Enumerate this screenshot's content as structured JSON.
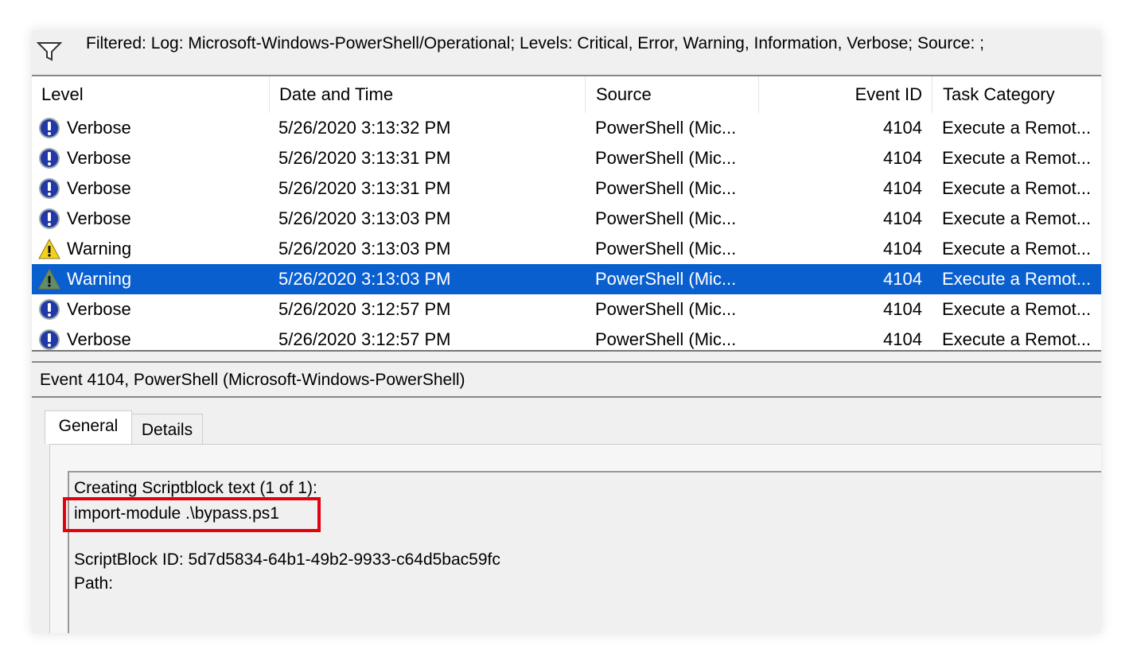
{
  "filter": {
    "icon": "funnel-icon",
    "text": "Filtered: Log: Microsoft-Windows-PowerShell/Operational; Levels: Critical, Error, Warning, Information, Verbose; Source: ;"
  },
  "columns": [
    "Level",
    "Date and Time",
    "Source",
    "Event ID",
    "Task Category"
  ],
  "rows": [
    {
      "level": "Verbose",
      "datetime": "5/26/2020 3:13:32 PM",
      "source": "PowerShell (Mic...",
      "event_id": "4104",
      "task": "Execute a Remot..."
    },
    {
      "level": "Verbose",
      "datetime": "5/26/2020 3:13:31 PM",
      "source": "PowerShell (Mic...",
      "event_id": "4104",
      "task": "Execute a Remot..."
    },
    {
      "level": "Verbose",
      "datetime": "5/26/2020 3:13:31 PM",
      "source": "PowerShell (Mic...",
      "event_id": "4104",
      "task": "Execute a Remot..."
    },
    {
      "level": "Verbose",
      "datetime": "5/26/2020 3:13:03 PM",
      "source": "PowerShell (Mic...",
      "event_id": "4104",
      "task": "Execute a Remot..."
    },
    {
      "level": "Warning",
      "datetime": "5/26/2020 3:13:03 PM",
      "source": "PowerShell (Mic...",
      "event_id": "4104",
      "task": "Execute a Remot..."
    },
    {
      "level": "Warning",
      "datetime": "5/26/2020 3:13:03 PM",
      "source": "PowerShell (Mic...",
      "event_id": "4104",
      "task": "Execute a Remot...",
      "selected": true
    },
    {
      "level": "Verbose",
      "datetime": "5/26/2020 3:12:57 PM",
      "source": "PowerShell (Mic...",
      "event_id": "4104",
      "task": "Execute a Remot..."
    },
    {
      "level": "Verbose",
      "datetime": "5/26/2020 3:12:57 PM",
      "source": "PowerShell (Mic...",
      "event_id": "4104",
      "task": "Execute a Remot..."
    }
  ],
  "event_header": "Event 4104, PowerShell (Microsoft-Windows-PowerShell)",
  "tabs": {
    "general": "General",
    "details": "Details"
  },
  "details": {
    "line1": "Creating Scriptblock text (1 of 1):",
    "line2": "import-module .\\bypass.ps1",
    "line3": "ScriptBlock ID: 5d7d5834-64b1-49b2-9933-c64d5bac59fc",
    "line4": "Path:"
  },
  "colors": {
    "selection": "#0a5fcf",
    "highlight": "#e4000f"
  }
}
